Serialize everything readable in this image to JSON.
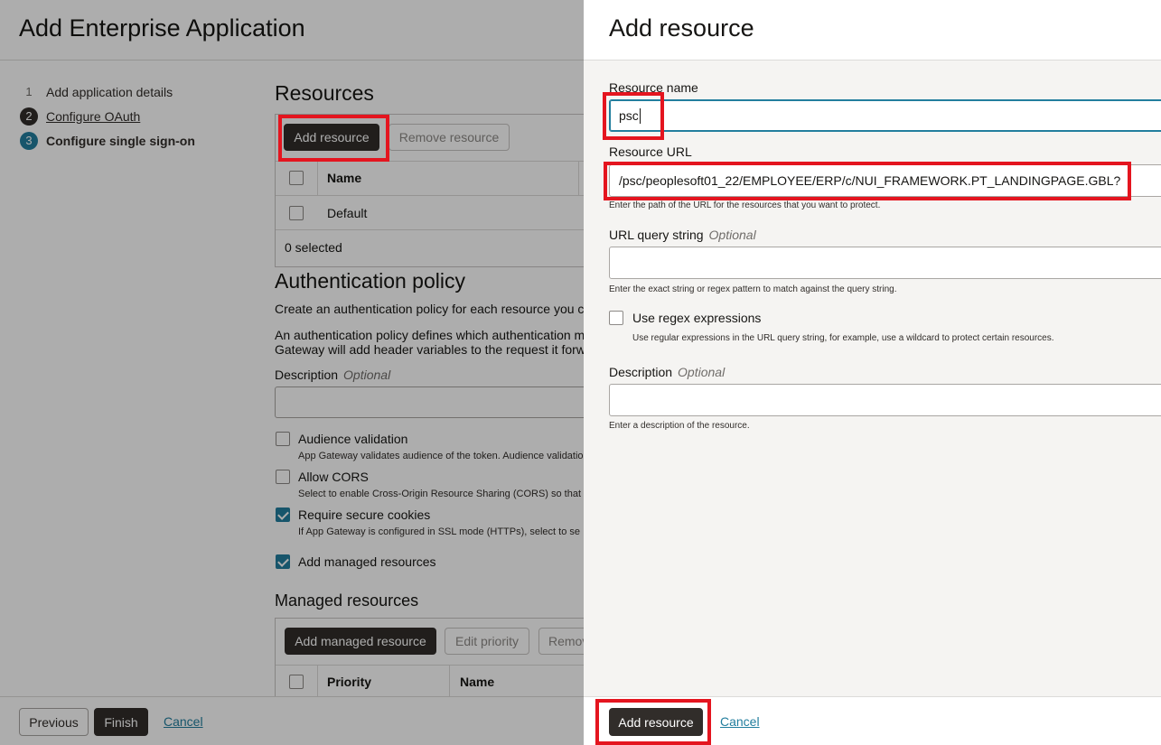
{
  "page": {
    "title": "Add Enterprise Application",
    "steps": [
      {
        "num": "1",
        "label": "Add application details"
      },
      {
        "num": "2",
        "label": "Configure OAuth"
      },
      {
        "num": "3",
        "label": "Configure single sign-on"
      }
    ],
    "resources": {
      "title": "Resources",
      "add_label": "Add resource",
      "remove_label": "Remove resource",
      "col_name": "Name",
      "rows": [
        "Default"
      ],
      "selected_count": "0 selected"
    },
    "auth_policy": {
      "title": "Authentication policy",
      "text1": "Create an authentication policy for each resource you c",
      "text2a": "An authentication policy defines which authentication m",
      "text2b": "Gateway will add header variables to the request it forw",
      "desc_label": "Description",
      "optional": "Optional",
      "audience_label": "Audience validation",
      "audience_help": "App Gateway validates audience of the token. Audience validatio",
      "cors_label": "Allow CORS",
      "cors_help": "Select to enable Cross-Origin Resource Sharing (CORS) so that",
      "secure_label": "Require secure cookies",
      "secure_help": "If App Gateway is configured in SSL mode (HTTPs), select to se",
      "managed_label": "Add managed resources"
    },
    "managed": {
      "title": "Managed resources",
      "add_label": "Add managed resource",
      "priority_label": "Edit priority",
      "remove_label": "Remov",
      "col_priority": "Priority",
      "col_name": "Name"
    },
    "footer": {
      "previous": "Previous",
      "finish": "Finish",
      "cancel": "Cancel"
    }
  },
  "drawer": {
    "title": "Add resource",
    "resource_name_label": "Resource name",
    "resource_name_value": "psc",
    "resource_url_label": "Resource URL",
    "resource_url_value": "/psc/peoplesoft01_22/EMPLOYEE/ERP/c/NUI_FRAMEWORK.PT_LANDINGPAGE.GBL?",
    "resource_url_help": "Enter the path of the URL for the resources that you want to protect.",
    "query_label": "URL query string",
    "query_optional": "Optional",
    "query_help": "Enter the exact string or regex pattern to match against the query string.",
    "regex_label": "Use regex expressions",
    "regex_help": "Use regular expressions in the URL query string, for example, use a wildcard to protect certain resources.",
    "desc_label": "Description",
    "desc_optional": "Optional",
    "desc_help": "Enter a description of the resource.",
    "add_button": "Add resource",
    "cancel": "Cancel"
  },
  "colors": {
    "accent": "#227e9e",
    "dark_button": "#312d2a",
    "highlight": "#e4151f"
  }
}
